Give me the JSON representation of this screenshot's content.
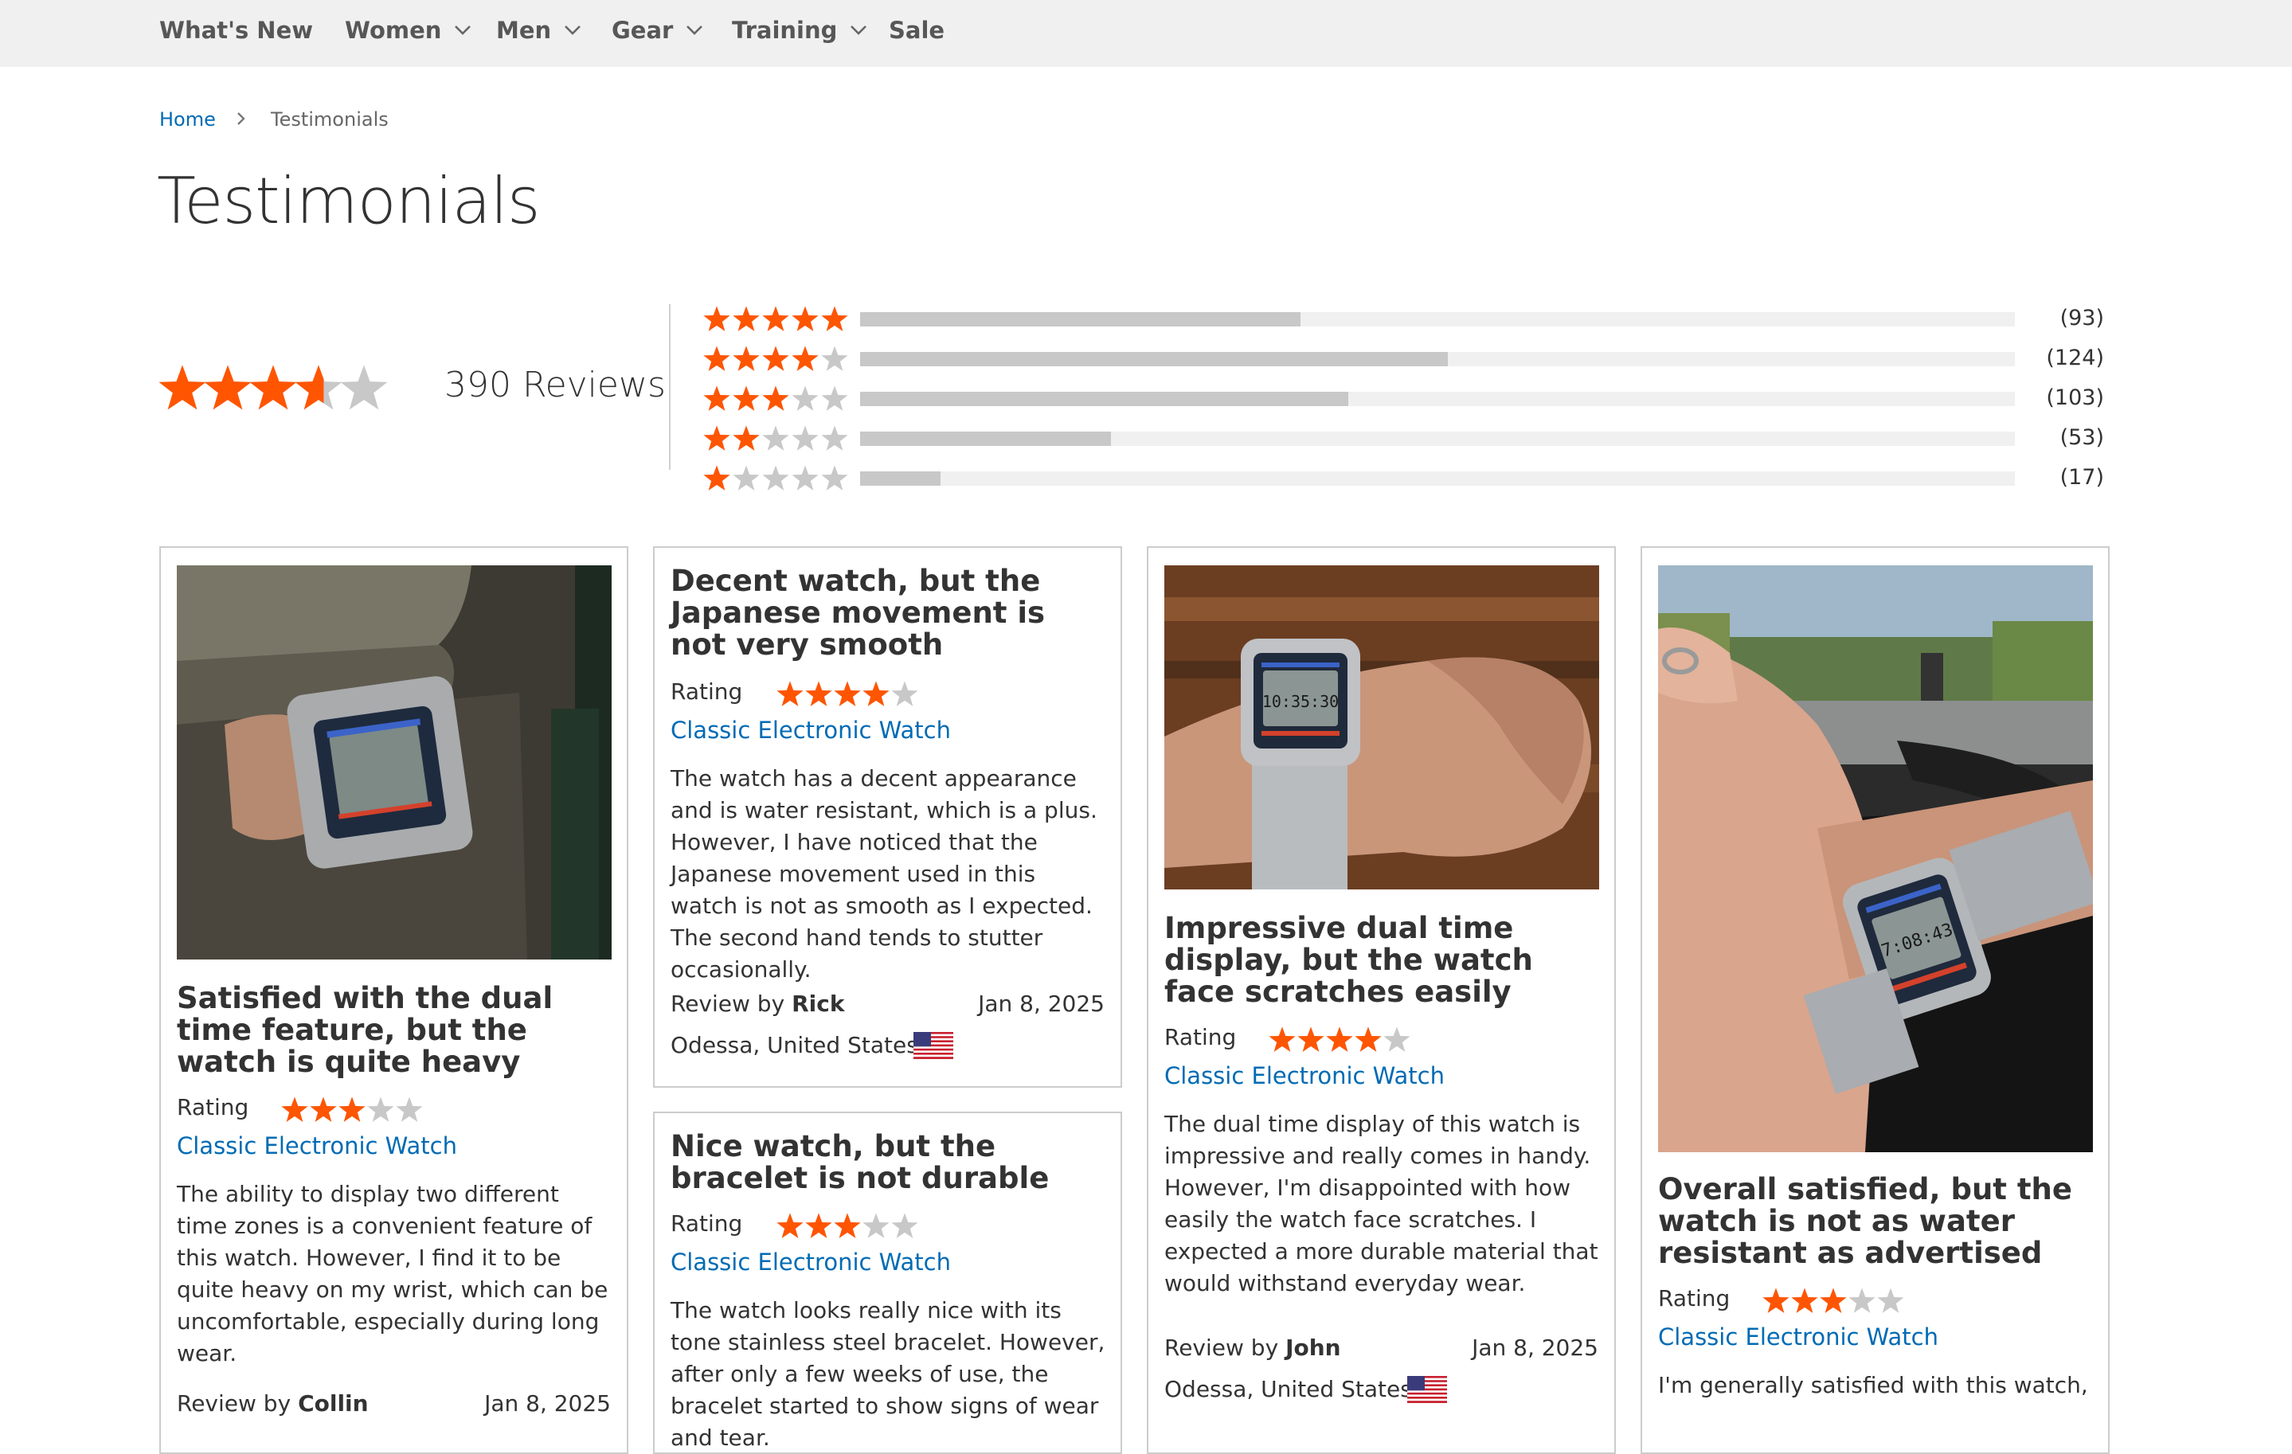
{
  "nav": {
    "items": [
      {
        "label": "What's New",
        "has_dropdown": false
      },
      {
        "label": "Women",
        "has_dropdown": true
      },
      {
        "label": "Men",
        "has_dropdown": true
      },
      {
        "label": "Gear",
        "has_dropdown": true
      },
      {
        "label": "Training",
        "has_dropdown": true
      },
      {
        "label": "Sale",
        "has_dropdown": false
      }
    ]
  },
  "breadcrumb": {
    "home": "Home",
    "separator_icon": "chevron-right-icon",
    "current": "Testimonials"
  },
  "page_title": "Testimonials",
  "summary": {
    "average_rating": 3.6,
    "max_rating": 5,
    "reviews_label": "390 Reviews",
    "breakdown": [
      {
        "stars": 5,
        "count": 93,
        "count_label": "(93)"
      },
      {
        "stars": 4,
        "count": 124,
        "count_label": "(124)"
      },
      {
        "stars": 3,
        "count": 103,
        "count_label": "(103)"
      },
      {
        "stars": 2,
        "count": 53,
        "count_label": "(53)"
      },
      {
        "stars": 1,
        "count": 17,
        "count_label": "(17)"
      }
    ]
  },
  "colors": {
    "star": "#ff5501",
    "star_empty": "#c8c8c8",
    "link": "#006bb4",
    "bar_fill": "#c8c8c8",
    "bar_track": "#f0f0f0"
  },
  "reviews": [
    {
      "title": "Satisfied with the dual time feature, but the watch is quite heavy",
      "rating_label": "Rating",
      "rating": 3,
      "product": "Classic Electronic Watch",
      "body": "The ability to display two different time zones is a convenient feature of this watch. However, I find it to be quite heavy on my wrist, which can be uncomfortable, especially during long wear.",
      "review_by": "Review by",
      "author": "Collin",
      "date": "Jan 8, 2025",
      "image": "watch-on-wrist-in-pocket"
    },
    {
      "title": "Decent watch, but the Japanese movement is not very smooth",
      "rating_label": "Rating",
      "rating": 4,
      "product": "Classic Electronic Watch",
      "body": "The watch has a decent appearance and is water resistant, which is a plus. However, I have noticed that the Japanese movement used in this watch is not as smooth as I expected. The second hand tends to stutter occasionally.",
      "review_by": "Review by",
      "author": "Rick",
      "date": "Jan 8, 2025",
      "location": "Odessa, United States",
      "flag": "us-flag-icon"
    },
    {
      "title": "Nice watch, but the bracelet is not durable",
      "rating_label": "Rating",
      "rating": 3,
      "product": "Classic Electronic Watch",
      "body": "The watch looks really nice with its tone stainless steel bracelet. However, after only a few weeks of use, the bracelet started to show signs of wear and tear."
    },
    {
      "title": "Impressive dual time display, but the watch face scratches easily",
      "rating_label": "Rating",
      "rating": 4,
      "product": "Classic Electronic Watch",
      "body": "The dual time display of this watch is impressive and really comes in handy. However, I'm disappointed with how easily the watch face scratches. I expected a more durable material that would withstand everyday wear.",
      "review_by": "Review by",
      "author": "John",
      "date": "Jan 8, 2025",
      "location": "Odessa, United States",
      "flag": "us-flag-icon",
      "image": "watch-on-fist-wood-background",
      "watch_display": "10:35:30"
    },
    {
      "title": "Overall satisfied, but the watch is not as water resistant as advertised",
      "rating_label": "Rating",
      "rating": 3,
      "product": "Classic Electronic Watch",
      "body": "I'm generally satisfied with this watch,",
      "image": "watch-on-wrist-steering-wheel",
      "watch_display": "7:08:43"
    }
  ]
}
